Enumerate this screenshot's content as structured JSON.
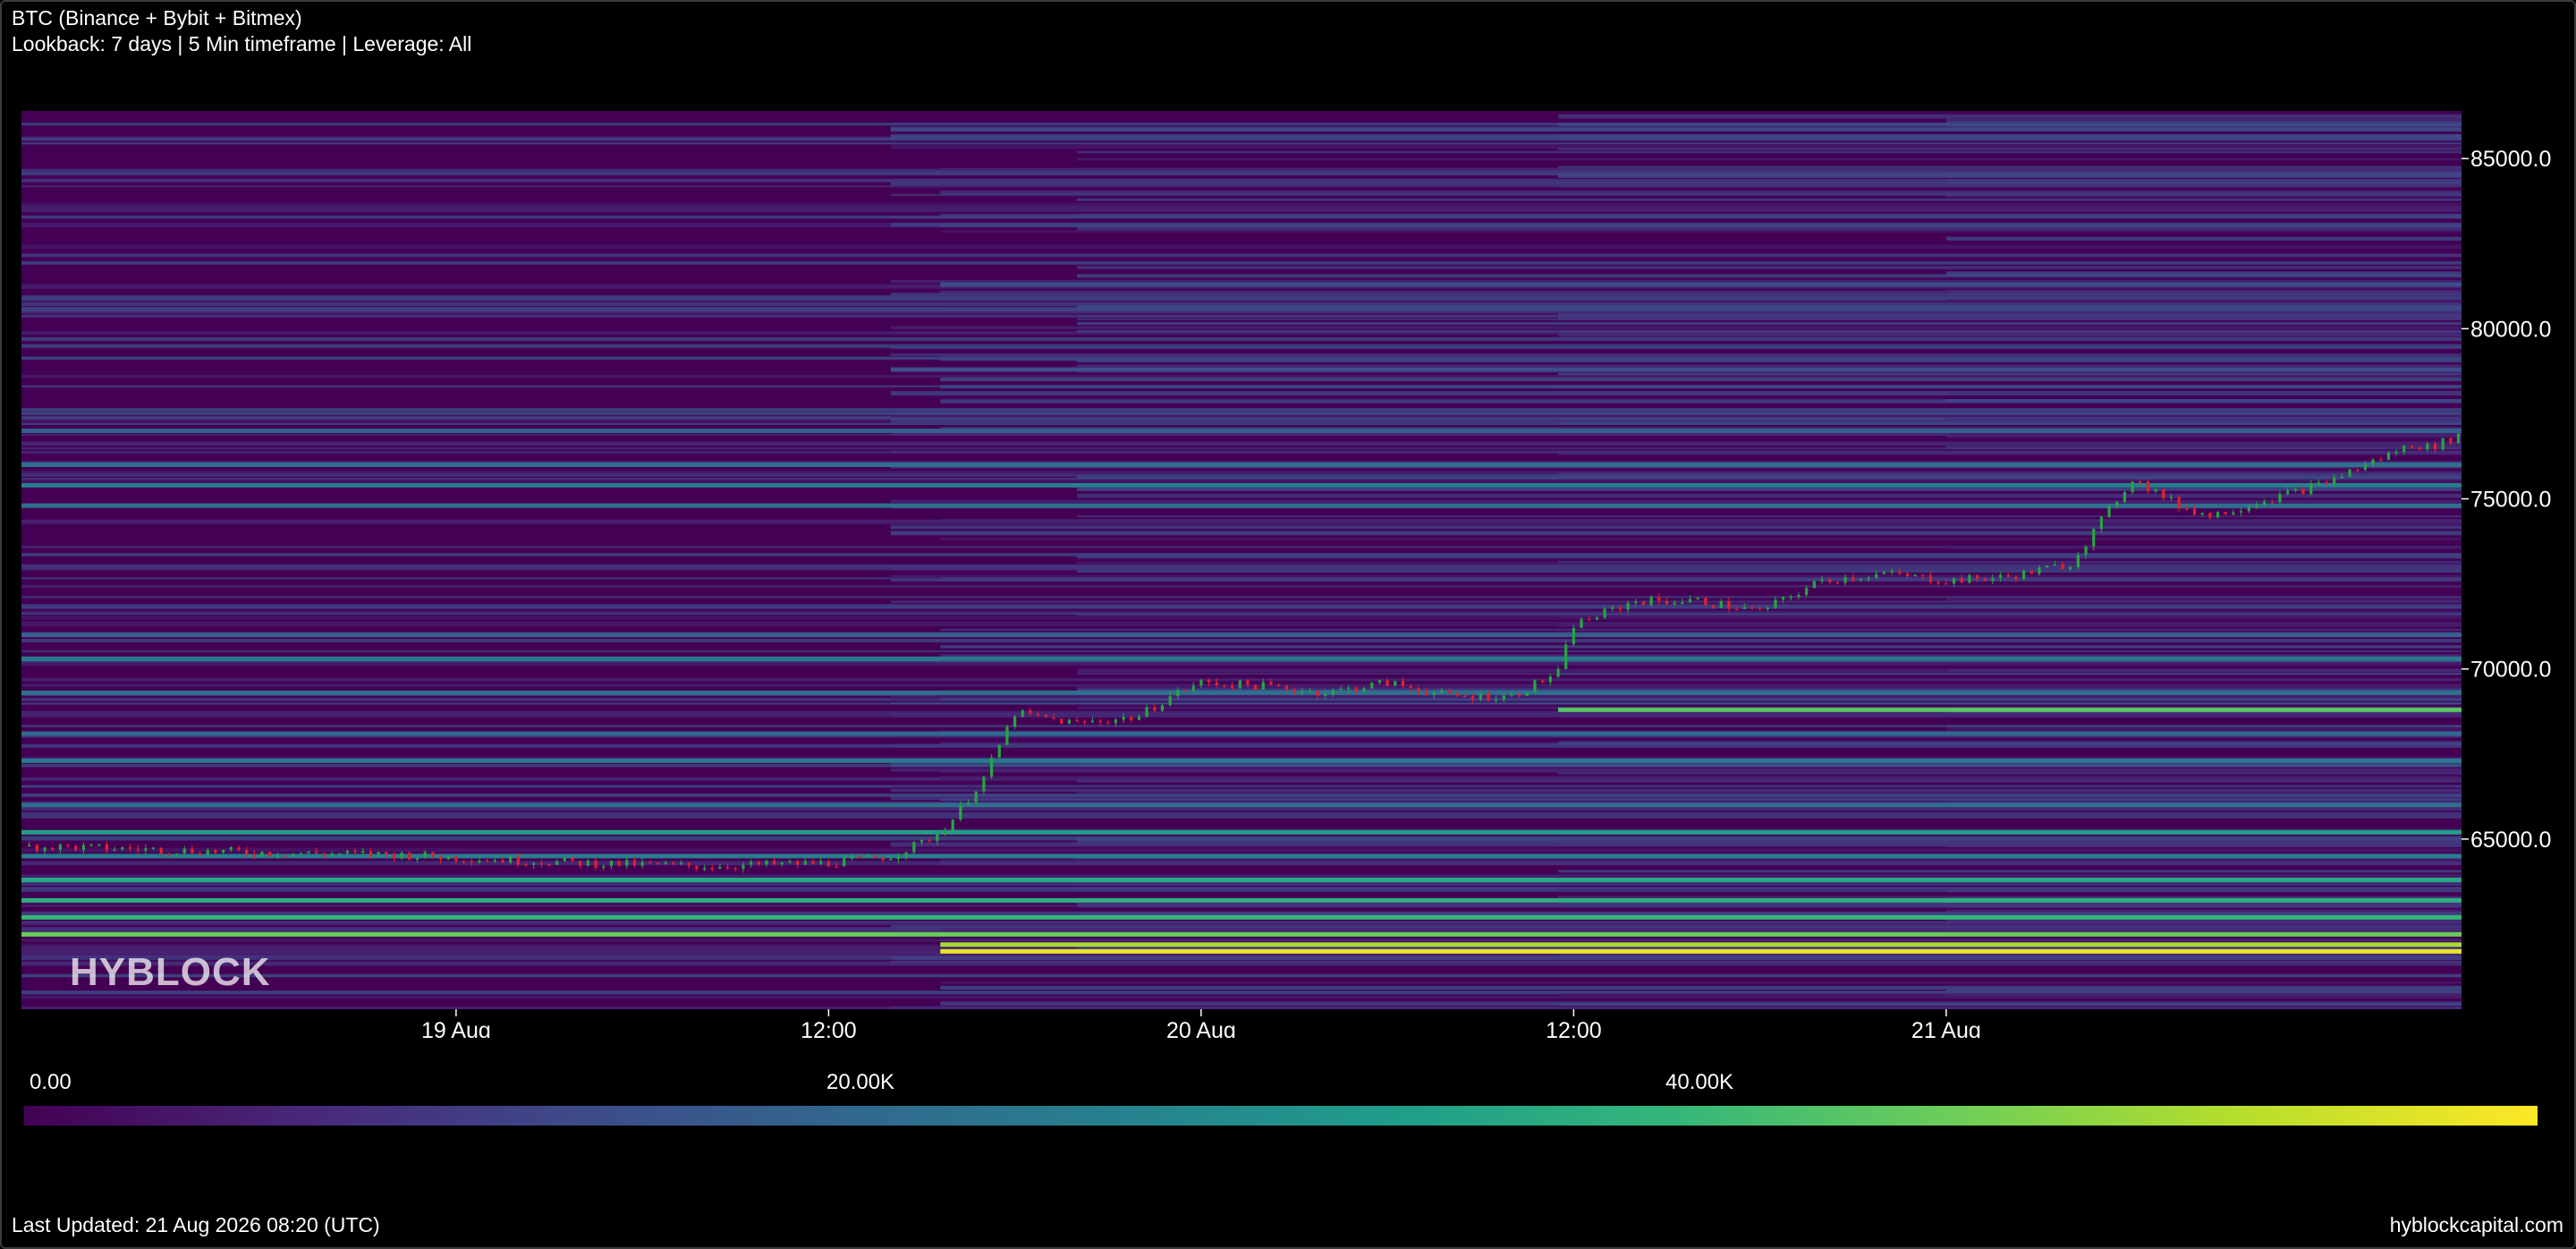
{
  "header": {
    "title": "BTC (Binance + Bybit + Bitmex)",
    "subtitle": "Lookback: 7 days | 5 Min timeframe | Leverage: All"
  },
  "watermark": "HYBLOCK",
  "colorbar": {
    "labels": [
      "0.00",
      "20.00K",
      "40.00K"
    ],
    "min": 0,
    "max": 60000,
    "colormap": "viridis"
  },
  "footer": {
    "last_updated": "Last Updated: 21 Aug 2026 08:20 (UTC)",
    "brand": "hyblockcapital.com"
  },
  "colors": {
    "background": "#000000",
    "heatmap_base": "#440154",
    "candle_up": "#26a641",
    "candle_down": "#e0222a"
  },
  "chart_data": {
    "type": "heatmap",
    "title": "BTC (Binance + Bybit + Bitmex)",
    "xlabel": "",
    "ylabel": "",
    "x_ticks": [
      {
        "label": "19 Aug",
        "t": 14
      },
      {
        "label": "12:00",
        "t": 26
      },
      {
        "label": "20 Aug",
        "t": 38
      },
      {
        "label": "12:00",
        "t": 50
      },
      {
        "label": "21 Aug",
        "t": 62
      }
    ],
    "x_range_hours": [
      0,
      78.6
    ],
    "y_ticks": [
      65000,
      70000,
      75000,
      80000,
      85000
    ],
    "ylim": [
      60000,
      86400
    ],
    "price_series": {
      "name": "BTC price",
      "t_hours": [
        0,
        4,
        8,
        12,
        14,
        18,
        22,
        26,
        28,
        29,
        29.6,
        30,
        31,
        32,
        34,
        36,
        37,
        38,
        40,
        42,
        44,
        46,
        48,
        49.5,
        50,
        52,
        54,
        56,
        58,
        60,
        62,
        64,
        66,
        68,
        69.5,
        70.5,
        72,
        74,
        76,
        77,
        77.6,
        78.6
      ],
      "price": [
        64800,
        64700,
        64600,
        64550,
        64450,
        64300,
        64200,
        64300,
        64500,
        64900,
        65200,
        65600,
        66800,
        68700,
        68400,
        68600,
        69200,
        69600,
        69500,
        69300,
        69600,
        69200,
        69200,
        69900,
        71300,
        72000,
        72000,
        71700,
        72600,
        72800,
        72600,
        72700,
        73100,
        75600,
        74800,
        74500,
        74900,
        75400,
        76200,
        76600,
        76500,
        76900
      ]
    },
    "liquidation_levels": [
      {
        "price": 61700,
        "intensity": 58000,
        "start_hour": 29.6
      },
      {
        "price": 61900,
        "intensity": 52000,
        "start_hour": 29.6
      },
      {
        "price": 62200,
        "intensity": 46000,
        "start_hour": 0
      },
      {
        "price": 62700,
        "intensity": 40000,
        "start_hour": 0
      },
      {
        "price": 63200,
        "intensity": 38000,
        "start_hour": 0
      },
      {
        "price": 63800,
        "intensity": 36000,
        "start_hour": 0
      },
      {
        "price": 64500,
        "intensity": 26000,
        "start_hour": 0
      },
      {
        "price": 65200,
        "intensity": 34000,
        "start_hour": 0
      },
      {
        "price": 66000,
        "intensity": 22000,
        "start_hour": 0
      },
      {
        "price": 67300,
        "intensity": 24000,
        "start_hour": 0
      },
      {
        "price": 68100,
        "intensity": 20000,
        "start_hour": 0
      },
      {
        "price": 68800,
        "intensity": 44000,
        "start_hour": 49.5
      },
      {
        "price": 69300,
        "intensity": 22000,
        "start_hour": 0
      },
      {
        "price": 70300,
        "intensity": 24000,
        "start_hour": 0
      },
      {
        "price": 71000,
        "intensity": 18000,
        "start_hour": 0
      },
      {
        "price": 74800,
        "intensity": 22000,
        "start_hour": 0
      },
      {
        "price": 75400,
        "intensity": 26000,
        "start_hour": 0
      },
      {
        "price": 76000,
        "intensity": 22000,
        "start_hour": 0
      },
      {
        "price": 77000,
        "intensity": 18000,
        "start_hour": 0
      },
      {
        "price": 78800,
        "intensity": 14000,
        "start_hour": 28
      },
      {
        "price": 81300,
        "intensity": 14000,
        "start_hour": 29.6
      },
      {
        "price": 84500,
        "intensity": 12000,
        "start_hour": 49.5
      }
    ]
  }
}
